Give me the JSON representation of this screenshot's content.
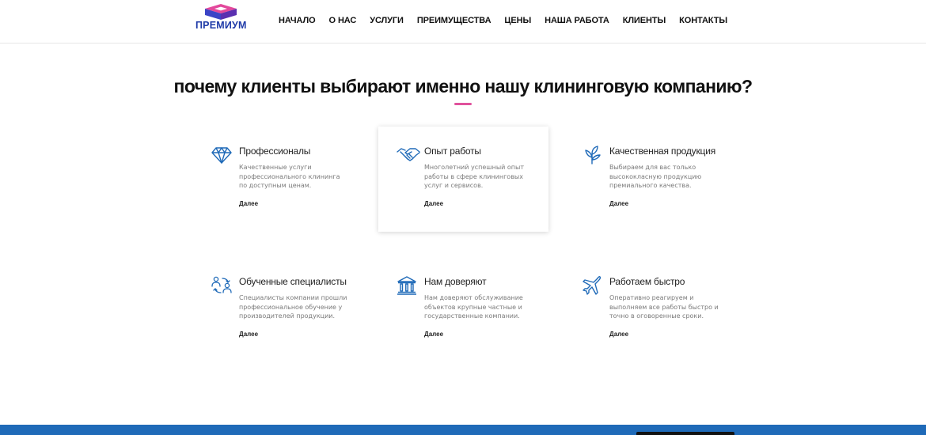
{
  "brand": {
    "name": "ПРЕМИУМ",
    "colors": {
      "top": "#e3489c",
      "side": "#3b44c6",
      "text": "#1e3aa8"
    }
  },
  "nav": [
    {
      "label": "НАЧАЛО"
    },
    {
      "label": "О НАС"
    },
    {
      "label": "УСЛУГИ"
    },
    {
      "label": "ПРЕИМУЩЕСТВА"
    },
    {
      "label": "ЦЕНЫ"
    },
    {
      "label": "НАША РАБОТА"
    },
    {
      "label": "КЛИЕНТЫ"
    },
    {
      "label": "КОНТАКТЫ"
    }
  ],
  "section": {
    "title": "почему клиенты выбирают именно нашу клининговую компанию?",
    "accent_color": "#e0529c",
    "icon_color": "#1f6ab8"
  },
  "features": [
    {
      "icon": "diamond-icon",
      "title": "Профессионалы",
      "desc": "Качественные услуги профессионального клининга по доступным ценам.",
      "more": "Далее"
    },
    {
      "icon": "handshake-icon",
      "title": "Опыт работы",
      "desc": "Многолетний успешный опыт работы в сфере клининговых услуг и сервисов.",
      "more": "Далее"
    },
    {
      "icon": "leaf-icon",
      "title": "Качественная продукция",
      "desc": "Выбираем для вас только высококласную продукцию премиального качества.",
      "more": "Далее"
    },
    {
      "icon": "people-exchange-icon",
      "title": "Обученные специалисты",
      "desc": "Специалисты компании прошли профессиональное обучение у производителей продукции.",
      "more": "Далее"
    },
    {
      "icon": "bank-icon",
      "title": "Нам доверяют",
      "desc": "Нам доверяют обслуживание объектов крупные частные и государственные компании.",
      "more": "Далее"
    },
    {
      "icon": "airplane-icon",
      "title": "Работаем быстро",
      "desc": "Оперативно реагируем и выполняем все работы быстро и точно в оговоренные сроки.",
      "more": "Далее"
    }
  ]
}
